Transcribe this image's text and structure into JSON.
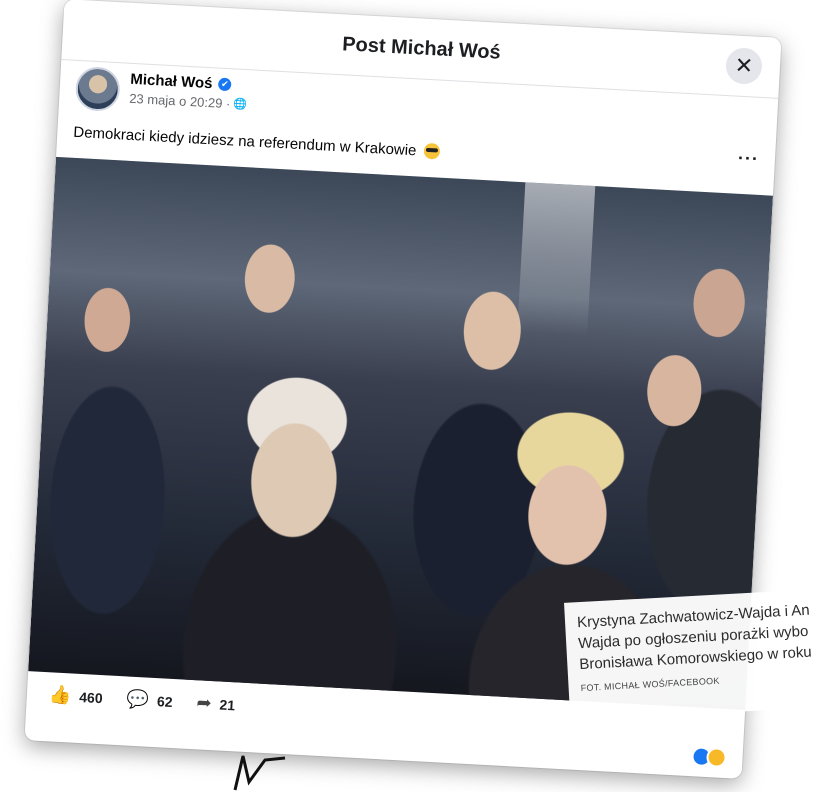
{
  "modal": {
    "title": "Post Michał Woś",
    "close_label": "✕"
  },
  "author": {
    "name": "Michał Woś",
    "timestamp": "23 maja o 20:29 ·",
    "verified_icon": "✔",
    "globe_icon": "🌐"
  },
  "post": {
    "text": "Demokraci kiedy idziesz na referendum w Krakowie",
    "more_label": "···"
  },
  "caption": {
    "text": "Krystyna Zachwatowicz-Wajda i An\nWajda po ogłoszeniu porażki wybo\nBronisława Komorowskiego w roku",
    "credit": "FOT. MICHAŁ WOŚ/FACEBOOK"
  },
  "reactions": {
    "likes": "460",
    "comments": "62",
    "shares": "21",
    "like_icon": "👍",
    "comment_icon": "💬",
    "share_icon": "➦"
  },
  "colors": {
    "accent": "#1877f2",
    "text": "#050505",
    "secondary": "#65676b"
  }
}
